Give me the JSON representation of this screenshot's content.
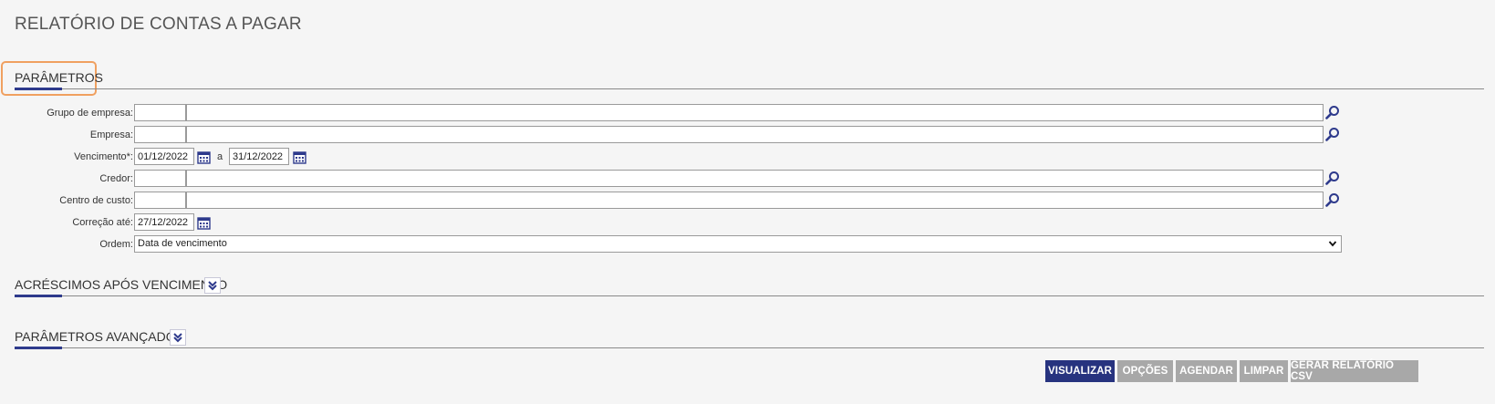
{
  "page": {
    "title": "RELATÓRIO DE CONTAS A PAGAR"
  },
  "sections": {
    "parametros": "PARÂMETROS",
    "acrescimos": "ACRÉSCIMOS APÓS VENCIMENTO",
    "avancados": "PARÂMETROS AVANÇADOS"
  },
  "form": {
    "grupo_empresa": {
      "label": "Grupo de empresa:",
      "code": "",
      "name": ""
    },
    "empresa": {
      "label": "Empresa:",
      "code": "",
      "name": ""
    },
    "vencimento": {
      "label": "Vencimento*:",
      "from": "01/12/2022",
      "separator": "a",
      "to": "31/12/2022"
    },
    "credor": {
      "label": "Credor:",
      "code": "",
      "name": ""
    },
    "centro_custo": {
      "label": "Centro de custo:",
      "code": "",
      "name": ""
    },
    "correcao": {
      "label": "Correção até:",
      "date": "27/12/2022"
    },
    "ordem": {
      "label": "Ordem:",
      "selected": "Data de vencimento"
    }
  },
  "buttons": {
    "visualizar": "VISUALIZAR",
    "opcoes": "OPÇÕES",
    "agendar": "AGENDAR",
    "limpar": "LIMPAR",
    "gerar_csv": "GERAR RELATÓRIO CSV"
  },
  "colors": {
    "primary": "#27337f",
    "disabled": "#a8a8a8",
    "focus": "#f0a060",
    "icon": "#2e3a8c"
  },
  "icons": {
    "search": "search-icon",
    "calendar": "calendar-icon",
    "expand": "double-chevron-down-icon",
    "dropdown": "chevron-down-icon"
  }
}
